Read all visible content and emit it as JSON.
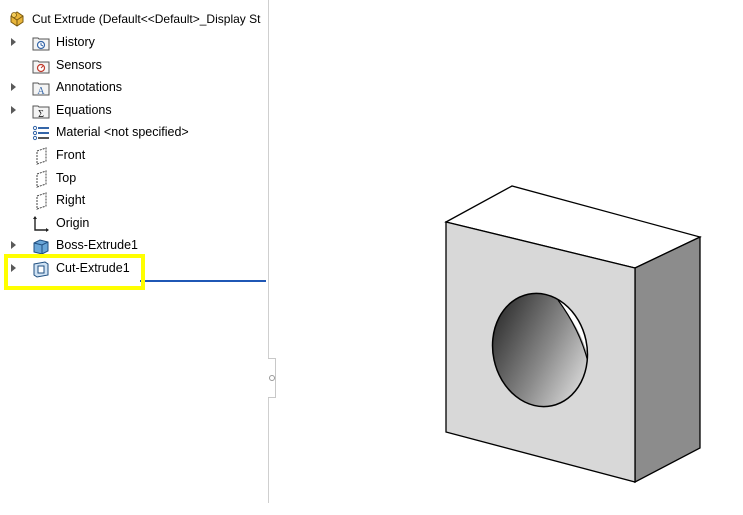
{
  "feature_tree": {
    "root": {
      "label": "Cut Extrude  (Default<<Default>_Display St",
      "icon": "part-icon"
    },
    "items": [
      {
        "label": "History",
        "icon": "history-folder-icon",
        "expandable": true
      },
      {
        "label": "Sensors",
        "icon": "sensors-folder-icon",
        "expandable": false
      },
      {
        "label": "Annotations",
        "icon": "annotations-folder-icon",
        "expandable": true
      },
      {
        "label": "Equations",
        "icon": "equations-folder-icon",
        "expandable": true
      },
      {
        "label": "Material <not specified>",
        "icon": "material-icon",
        "expandable": false
      },
      {
        "label": "Front",
        "icon": "plane-icon",
        "expandable": false
      },
      {
        "label": "Top",
        "icon": "plane-icon",
        "expandable": false
      },
      {
        "label": "Right",
        "icon": "plane-icon",
        "expandable": false
      },
      {
        "label": "Origin",
        "icon": "origin-icon",
        "expandable": false
      },
      {
        "label": "Boss-Extrude1",
        "icon": "boss-extrude-icon",
        "expandable": true
      },
      {
        "label": "Cut-Extrude1",
        "icon": "cut-extrude-icon",
        "expandable": true,
        "highlighted": true
      }
    ]
  },
  "colors": {
    "highlight": "#ffff00",
    "rollback_bar": "#1f57b5",
    "model_front_face": "#d8d8d8",
    "model_side_face": "#8c8c8c",
    "model_top_face": "#ffffff"
  },
  "viewport": {
    "model": "block-with-through-hole"
  }
}
